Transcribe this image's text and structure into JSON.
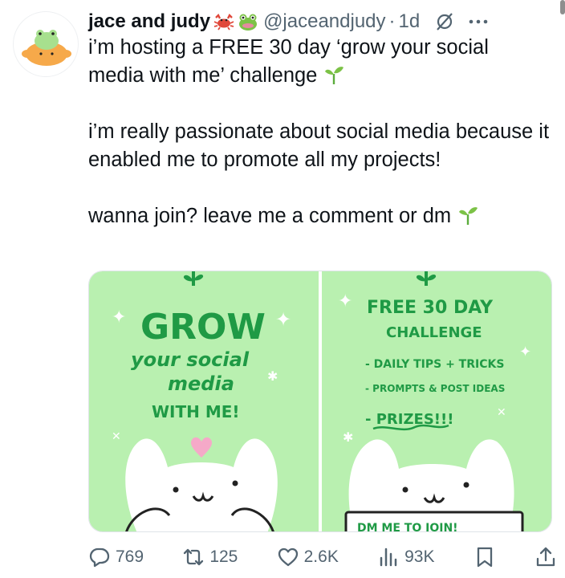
{
  "post": {
    "display_name": "jace and judy",
    "name_emojis": [
      "crab-emoji",
      "frog-emoji"
    ],
    "handle": "@jaceandjudy",
    "separator": "·",
    "timestamp": "1d",
    "text": {
      "line1": "i’m hosting a FREE 30 day ‘grow your social",
      "line2": "media with me’ challenge",
      "para2": "i’m really passionate about social media because it enabled me to promote all my projects!",
      "para3": "wanna join? leave me a comment or dm"
    }
  },
  "media": {
    "left": {
      "title": "GROW",
      "line2": "your social",
      "line3": "media",
      "line4": "WITH ME!"
    },
    "right": {
      "title1": "FREE 30 DAY",
      "title2": "CHALLENGE",
      "item1": "- DAILY TIPS + TRICKS",
      "item2": "- PROMPTS & POST IDEAS",
      "item3": "- PRIZES!!!",
      "sign": "DM ME TO JOIN!"
    }
  },
  "actions": {
    "replies": "769",
    "reposts": "125",
    "likes": "2.6K",
    "views": "93K"
  },
  "colors": {
    "text": "#0f1419",
    "secondary": "#536471",
    "panel_bg": "#b9f0b0",
    "hand_green": "#1f9a45"
  },
  "icons": [
    "grok-icon",
    "more-icon",
    "reply-icon",
    "repost-icon",
    "like-icon",
    "views-icon",
    "bookmark-icon",
    "share-icon"
  ]
}
